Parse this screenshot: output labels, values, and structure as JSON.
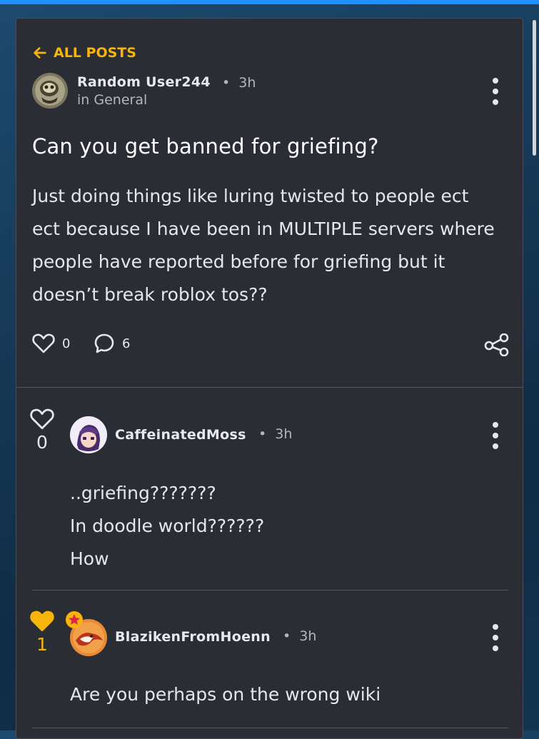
{
  "nav": {
    "back_label": "ALL POSTS"
  },
  "post": {
    "author": "Random User244",
    "time": "3h",
    "category": "in General",
    "title": "Can you get banned for griefing?",
    "body_lines": [
      "Just doing things like luring twisted to people ect",
      "ect because I have been in MULTIPLE servers where",
      "people have reported before for griefing but it",
      "doesn’t break roblox tos??"
    ],
    "likes": "0",
    "comments": "6"
  },
  "replies": [
    {
      "author": "CaffeinatedMoss",
      "time": "3h",
      "likes": "0",
      "liked": false,
      "lines": [
        "..griefing???????",
        "In doodle world??????",
        "How"
      ]
    },
    {
      "author": "BlazikenFromHoenn",
      "time": "3h",
      "likes": "1",
      "liked": true,
      "lines": [
        "Are you perhaps on the wrong wiki"
      ]
    }
  ],
  "colors": {
    "accent": "#f5b50a",
    "card_bg": "#2b2d35",
    "page_bg": "#163a58",
    "text": "#e6e7ea",
    "topbar": "#1e90ff"
  },
  "icons": {
    "back": "arrow-left-icon",
    "more": "kebab-menu-icon",
    "like": "heart-icon",
    "comment": "speech-bubble-icon",
    "share": "share-icon",
    "badge": "star-badge-icon"
  }
}
